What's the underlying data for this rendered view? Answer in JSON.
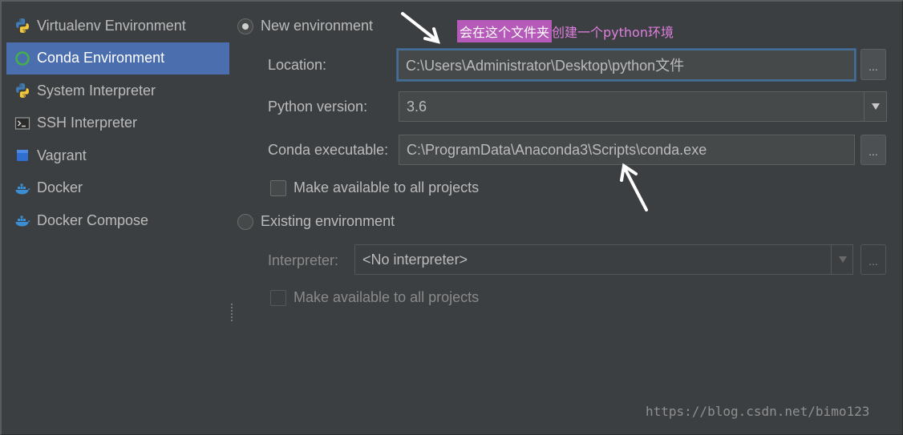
{
  "sidebar": {
    "items": [
      {
        "label": "Virtualenv Environment",
        "icon": "python-icon",
        "selected": false
      },
      {
        "label": "Conda Environment",
        "icon": "conda-icon",
        "selected": true
      },
      {
        "label": "System Interpreter",
        "icon": "python-icon",
        "selected": false
      },
      {
        "label": "SSH Interpreter",
        "icon": "terminal-icon",
        "selected": false
      },
      {
        "label": "Vagrant",
        "icon": "vagrant-icon",
        "selected": false
      },
      {
        "label": "Docker",
        "icon": "docker-icon",
        "selected": false
      },
      {
        "label": "Docker Compose",
        "icon": "docker-icon",
        "selected": false
      }
    ]
  },
  "new_env": {
    "radio_label": "New environment",
    "selected": true,
    "location_label": "Location:",
    "location_value": "C:\\Users\\Administrator\\Desktop\\python文件",
    "python_version_label": "Python version:",
    "python_version_value": "3.6",
    "conda_exec_label": "Conda executable:",
    "conda_exec_value": "C:\\ProgramData\\Anaconda3\\Scripts\\conda.exe",
    "make_available_label": "Make available to all projects",
    "browse_label": "..."
  },
  "existing_env": {
    "radio_label": "Existing environment",
    "selected": false,
    "interpreter_label": "Interpreter:",
    "interpreter_value": "<No interpreter>",
    "make_available_label": "Make available to all projects",
    "browse_label": "..."
  },
  "annotation": {
    "highlight_text": "会在这个文件夹",
    "rest_text": "创建一个python环境"
  },
  "watermark": "https://blog.csdn.net/bimo123",
  "colors": {
    "background": "#3c3f41",
    "selection": "#4b6eaf",
    "annotation_highlight": "#b55ab8",
    "focus_border": "#466d94"
  }
}
